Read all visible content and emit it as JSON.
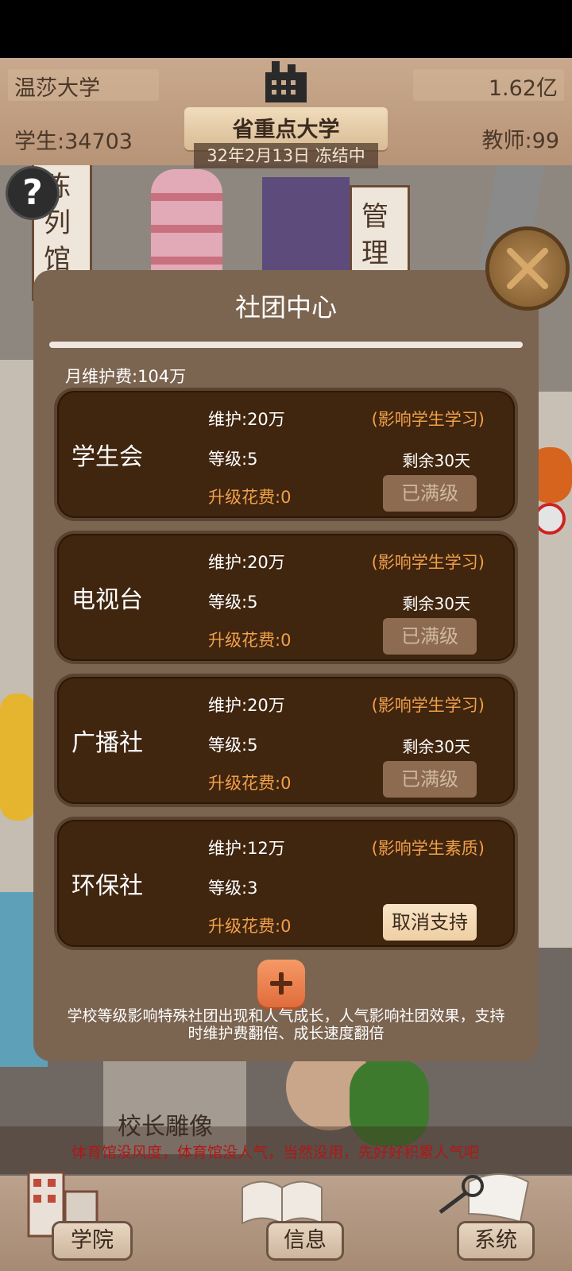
{
  "hud": {
    "school_name": "温莎大学",
    "money": "1.62亿",
    "students": "学生:34703",
    "teachers": "教师:99",
    "rank_title": "省重点大学",
    "date_status": "32年2月13日 冻结中"
  },
  "scene": {
    "building1": "陈列馆",
    "building2": "管理",
    "statue": "校长雕像"
  },
  "dialog": {
    "title": "社团中心",
    "monthly_fee": "月维护费:104万",
    "clubs": [
      {
        "name": "学生会",
        "maintenance": "维护:20万",
        "effect": "(影响学生学习)",
        "level": "等级:5",
        "remaining": "剩余30天",
        "upgrade_cost": "升级花费:0",
        "button": "已满级"
      },
      {
        "name": "电视台",
        "maintenance": "维护:20万",
        "effect": "(影响学生学习)",
        "level": "等级:5",
        "remaining": "剩余30天",
        "upgrade_cost": "升级花费:0",
        "button": "已满级"
      },
      {
        "name": "广播社",
        "maintenance": "维护:20万",
        "effect": "(影响学生学习)",
        "level": "等级:5",
        "remaining": "剩余30天",
        "upgrade_cost": "升级花费:0",
        "button": "已满级"
      },
      {
        "name": "环保社",
        "maintenance": "维护:12万",
        "effect": "(影响学生素质)",
        "level": "等级:3",
        "remaining": "",
        "upgrade_cost": "升级花费:0",
        "button": "取消支持"
      }
    ],
    "hint_line1": "学校等级影响特殊社团出现和人气成长，人气影响社团效果，支持",
    "hint_line2": "时维护费翻倍、成长速度翻倍"
  },
  "ticker": "体育馆没风度，体育馆没人气，当然没用，先好好积累人气吧",
  "nav": {
    "college": "学院",
    "info": "信息",
    "system": "系统"
  },
  "colors": {
    "accent_orange": "#f0a04a",
    "card_bg": "#40250f",
    "dialog_bg": "#7b6450",
    "ticker_red": "#b01818"
  }
}
